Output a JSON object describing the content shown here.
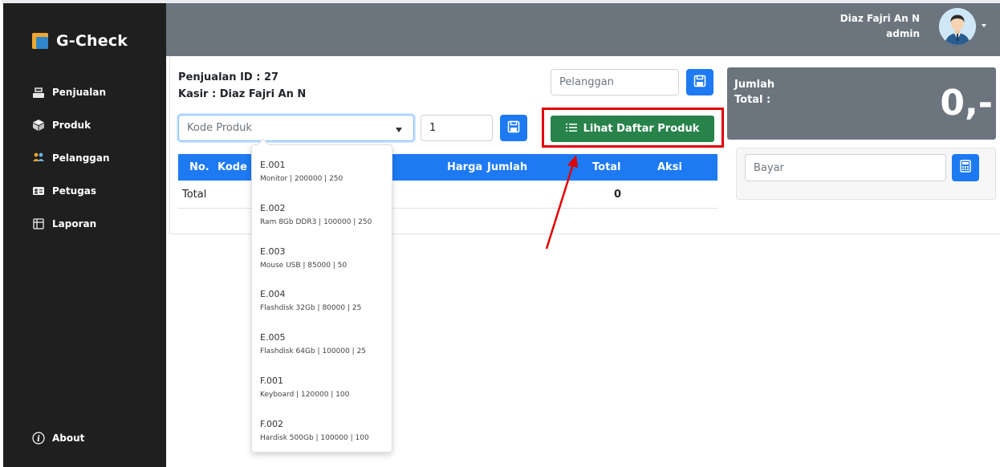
{
  "app": {
    "name": "G-Check"
  },
  "sidebar": {
    "items": [
      {
        "label": "Penjualan",
        "icon": "cash-register-icon"
      },
      {
        "label": "Produk",
        "icon": "box-icon"
      },
      {
        "label": "Pelanggan",
        "icon": "users-icon"
      },
      {
        "label": "Petugas",
        "icon": "id-card-icon"
      },
      {
        "label": "Laporan",
        "icon": "report-icon"
      }
    ],
    "about_label": "About"
  },
  "user": {
    "name": "Diaz Fajri An N",
    "role": "admin"
  },
  "sale": {
    "id_label": "Penjualan ID : 27",
    "cashier_label": "Kasir : Diaz Fajri An N",
    "customer_placeholder": "Pelanggan",
    "product_placeholder": "Kode Produk",
    "quantity_value": "1",
    "list_button_label": "Lihat Daftar Produk"
  },
  "table": {
    "headers": [
      "No.",
      "Kode",
      "Harga",
      "Jumlah",
      "Total",
      "Aksi"
    ],
    "total_row": {
      "label": "Total",
      "value": "0"
    }
  },
  "summary": {
    "jumlah_label": "Jumlah",
    "total_label": "Total :",
    "total_value": "0,-",
    "bayar_placeholder": "Bayar"
  },
  "dropdown": {
    "items": [
      {
        "code": "E.001",
        "desc": "Monitor | 200000 | 250"
      },
      {
        "code": "E.002",
        "desc": "Ram 8Gb DDR3 | 100000 | 250"
      },
      {
        "code": "E.003",
        "desc": "Mouse USB | 85000 | 50"
      },
      {
        "code": "E.004",
        "desc": "Flashdisk 32Gb | 80000 | 25"
      },
      {
        "code": "E.005",
        "desc": "Flashdisk 64Gb | 100000 | 25"
      },
      {
        "code": "F.001",
        "desc": "Keyboard | 120000 | 100"
      },
      {
        "code": "F.002",
        "desc": "Hardisk 500Gb | 100000 | 100"
      }
    ]
  },
  "colors": {
    "sidebar": "#1f1f1f",
    "topbar": "#6c757d",
    "primary": "#1d7af3",
    "success": "#28834a",
    "highlight": "#e00000"
  }
}
